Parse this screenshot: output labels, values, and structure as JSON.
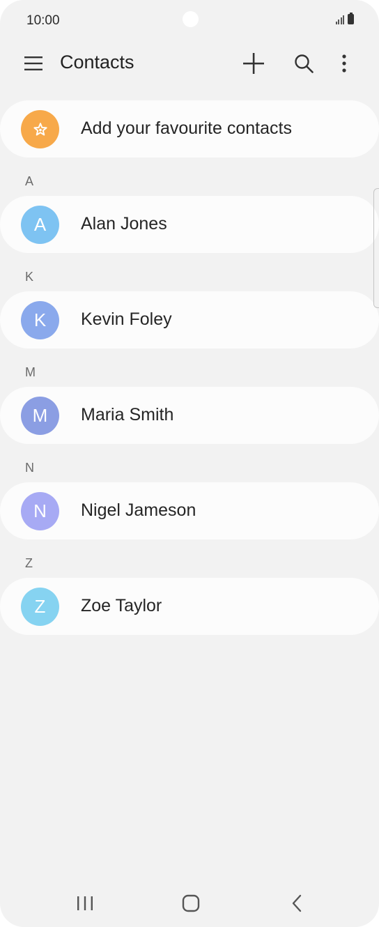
{
  "status_bar": {
    "time": "10:00"
  },
  "toolbar": {
    "title": "Contacts",
    "icons": {
      "menu": "hamburger-menu-icon",
      "add": "plus-icon",
      "search": "search-icon",
      "more": "more-vertical-icon"
    }
  },
  "favourites": {
    "label": "Add your favourite contacts",
    "icon": "star-icon",
    "color": "#f7a94a"
  },
  "contacts": [
    {
      "section": "A",
      "initial": "A",
      "name": "Alan Jones",
      "color": "#7ec3f2"
    },
    {
      "section": "K",
      "initial": "K",
      "name": "Kevin Foley",
      "color": "#8aa9ec"
    },
    {
      "section": "M",
      "initial": "M",
      "name": "Maria Smith",
      "color": "#8b9ee3"
    },
    {
      "section": "N",
      "initial": "N",
      "name": "Nigel Jameson",
      "color": "#a7aaf4"
    },
    {
      "section": "Z",
      "initial": "Z",
      "name": "Zoe Taylor",
      "color": "#86d3f1"
    }
  ],
  "nav_bar": {
    "icons": {
      "recents": "recent-apps-icon",
      "home": "home-icon",
      "back": "back-chevron-icon"
    }
  }
}
